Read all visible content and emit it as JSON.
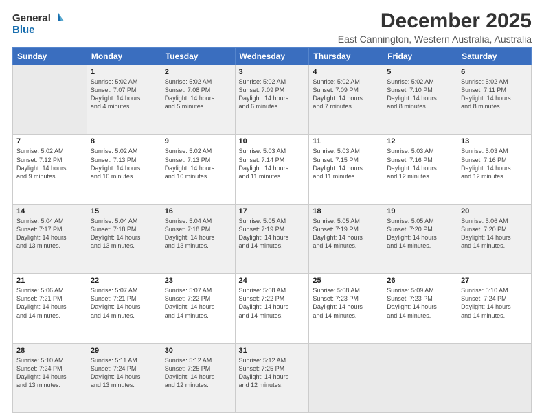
{
  "header": {
    "logo": {
      "general": "General",
      "blue": "Blue"
    },
    "title": "December 2025",
    "location": "East Cannington, Western Australia, Australia"
  },
  "weekdays": [
    "Sunday",
    "Monday",
    "Tuesday",
    "Wednesday",
    "Thursday",
    "Friday",
    "Saturday"
  ],
  "weeks": [
    [
      {
        "date": "",
        "info": ""
      },
      {
        "date": "1",
        "info": "Sunrise: 5:02 AM\nSunset: 7:07 PM\nDaylight: 14 hours\nand 4 minutes."
      },
      {
        "date": "2",
        "info": "Sunrise: 5:02 AM\nSunset: 7:08 PM\nDaylight: 14 hours\nand 5 minutes."
      },
      {
        "date": "3",
        "info": "Sunrise: 5:02 AM\nSunset: 7:09 PM\nDaylight: 14 hours\nand 6 minutes."
      },
      {
        "date": "4",
        "info": "Sunrise: 5:02 AM\nSunset: 7:09 PM\nDaylight: 14 hours\nand 7 minutes."
      },
      {
        "date": "5",
        "info": "Sunrise: 5:02 AM\nSunset: 7:10 PM\nDaylight: 14 hours\nand 8 minutes."
      },
      {
        "date": "6",
        "info": "Sunrise: 5:02 AM\nSunset: 7:11 PM\nDaylight: 14 hours\nand 8 minutes."
      }
    ],
    [
      {
        "date": "7",
        "info": "Sunrise: 5:02 AM\nSunset: 7:12 PM\nDaylight: 14 hours\nand 9 minutes."
      },
      {
        "date": "8",
        "info": "Sunrise: 5:02 AM\nSunset: 7:13 PM\nDaylight: 14 hours\nand 10 minutes."
      },
      {
        "date": "9",
        "info": "Sunrise: 5:02 AM\nSunset: 7:13 PM\nDaylight: 14 hours\nand 10 minutes."
      },
      {
        "date": "10",
        "info": "Sunrise: 5:03 AM\nSunset: 7:14 PM\nDaylight: 14 hours\nand 11 minutes."
      },
      {
        "date": "11",
        "info": "Sunrise: 5:03 AM\nSunset: 7:15 PM\nDaylight: 14 hours\nand 11 minutes."
      },
      {
        "date": "12",
        "info": "Sunrise: 5:03 AM\nSunset: 7:16 PM\nDaylight: 14 hours\nand 12 minutes."
      },
      {
        "date": "13",
        "info": "Sunrise: 5:03 AM\nSunset: 7:16 PM\nDaylight: 14 hours\nand 12 minutes."
      }
    ],
    [
      {
        "date": "14",
        "info": "Sunrise: 5:04 AM\nSunset: 7:17 PM\nDaylight: 14 hours\nand 13 minutes."
      },
      {
        "date": "15",
        "info": "Sunrise: 5:04 AM\nSunset: 7:18 PM\nDaylight: 14 hours\nand 13 minutes."
      },
      {
        "date": "16",
        "info": "Sunrise: 5:04 AM\nSunset: 7:18 PM\nDaylight: 14 hours\nand 13 minutes."
      },
      {
        "date": "17",
        "info": "Sunrise: 5:05 AM\nSunset: 7:19 PM\nDaylight: 14 hours\nand 14 minutes."
      },
      {
        "date": "18",
        "info": "Sunrise: 5:05 AM\nSunset: 7:19 PM\nDaylight: 14 hours\nand 14 minutes."
      },
      {
        "date": "19",
        "info": "Sunrise: 5:05 AM\nSunset: 7:20 PM\nDaylight: 14 hours\nand 14 minutes."
      },
      {
        "date": "20",
        "info": "Sunrise: 5:06 AM\nSunset: 7:20 PM\nDaylight: 14 hours\nand 14 minutes."
      }
    ],
    [
      {
        "date": "21",
        "info": "Sunrise: 5:06 AM\nSunset: 7:21 PM\nDaylight: 14 hours\nand 14 minutes."
      },
      {
        "date": "22",
        "info": "Sunrise: 5:07 AM\nSunset: 7:21 PM\nDaylight: 14 hours\nand 14 minutes."
      },
      {
        "date": "23",
        "info": "Sunrise: 5:07 AM\nSunset: 7:22 PM\nDaylight: 14 hours\nand 14 minutes."
      },
      {
        "date": "24",
        "info": "Sunrise: 5:08 AM\nSunset: 7:22 PM\nDaylight: 14 hours\nand 14 minutes."
      },
      {
        "date": "25",
        "info": "Sunrise: 5:08 AM\nSunset: 7:23 PM\nDaylight: 14 hours\nand 14 minutes."
      },
      {
        "date": "26",
        "info": "Sunrise: 5:09 AM\nSunset: 7:23 PM\nDaylight: 14 hours\nand 14 minutes."
      },
      {
        "date": "27",
        "info": "Sunrise: 5:10 AM\nSunset: 7:24 PM\nDaylight: 14 hours\nand 14 minutes."
      }
    ],
    [
      {
        "date": "28",
        "info": "Sunrise: 5:10 AM\nSunset: 7:24 PM\nDaylight: 14 hours\nand 13 minutes."
      },
      {
        "date": "29",
        "info": "Sunrise: 5:11 AM\nSunset: 7:24 PM\nDaylight: 14 hours\nand 13 minutes."
      },
      {
        "date": "30",
        "info": "Sunrise: 5:12 AM\nSunset: 7:25 PM\nDaylight: 14 hours\nand 12 minutes."
      },
      {
        "date": "31",
        "info": "Sunrise: 5:12 AM\nSunset: 7:25 PM\nDaylight: 14 hours\nand 12 minutes."
      },
      {
        "date": "",
        "info": ""
      },
      {
        "date": "",
        "info": ""
      },
      {
        "date": "",
        "info": ""
      }
    ]
  ]
}
